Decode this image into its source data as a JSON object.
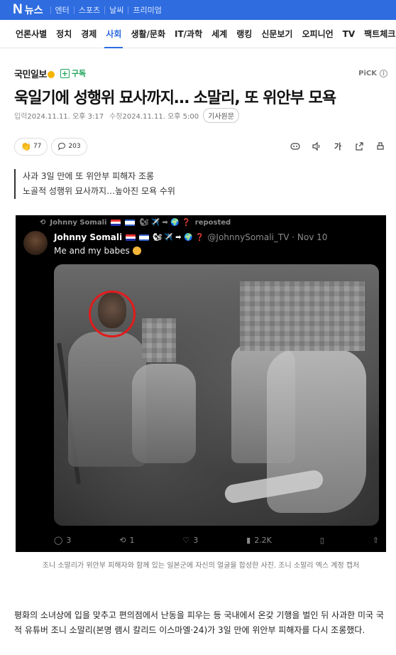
{
  "topbar": {
    "logo_mark": "N",
    "logo_text": "뉴스",
    "links": [
      "엔터",
      "스포츠",
      "날씨",
      "프리미엄"
    ]
  },
  "sections": [
    "언론사별",
    "정치",
    "경제",
    "사회",
    "생활/문화",
    "IT/과학",
    "세계",
    "랭킹",
    "신문보기",
    "오피니언",
    "TV",
    "팩트체크"
  ],
  "active_section": "사회",
  "press": {
    "name": "국민일보",
    "subscribe_label": "구독",
    "pick_label": "PiCK"
  },
  "article": {
    "headline": "욱일기에 성행위 묘사까지… 소말리, 또 위안부 모욕",
    "input_label": "입력",
    "input_time": "2024.11.11. 오후 3:17",
    "modified_label": "수정",
    "modified_time": "2024.11.11. 오후 5:00",
    "original_button": "기사원문",
    "reactions": [
      {
        "icon": "👏",
        "count": "77"
      },
      {
        "icon": "💬",
        "count": "203"
      }
    ],
    "tools": [
      "audio-icon",
      "volume-icon",
      "font-size-icon",
      "share-icon",
      "print-icon"
    ],
    "font_tool_label": "가",
    "summary": [
      "사과 3일 만에 또 위안부 피해자 조롱",
      "노골적 성행위 묘사까지…높아진 모욕 수위"
    ],
    "caption": "조니 소말리가 위안부 피해자와 함께 있는 일본군에 자신의 얼굴을 합성한 사진. 조니 소말리 엑스 계정 캡처",
    "body": "평화의 소녀상에 입을 맞추고 편의점에서 난동을 피우는 등 국내에서 온갖 기행을 벌인 뒤 사과한 미국 국적 유튜버 조니 소말리(본명 램시 칼리드 이스마엘·24)가 3일 만에 위안부 피해자를 다시 조롱했다."
  },
  "tweet": {
    "repost_name": "Johnny Somali",
    "repost_suffix": "reposted",
    "name": "Johnny Somali",
    "handle": "@JohnnySomali_TV · Nov 10",
    "text": "Me and my babes",
    "replies": "3",
    "retweets": "1",
    "likes": "3",
    "views": "2.2K"
  },
  "colors": {
    "brand_blue": "#2e6ce0",
    "subscribe_green": "#1fa35b",
    "highlight_red": "#e21b1b"
  }
}
